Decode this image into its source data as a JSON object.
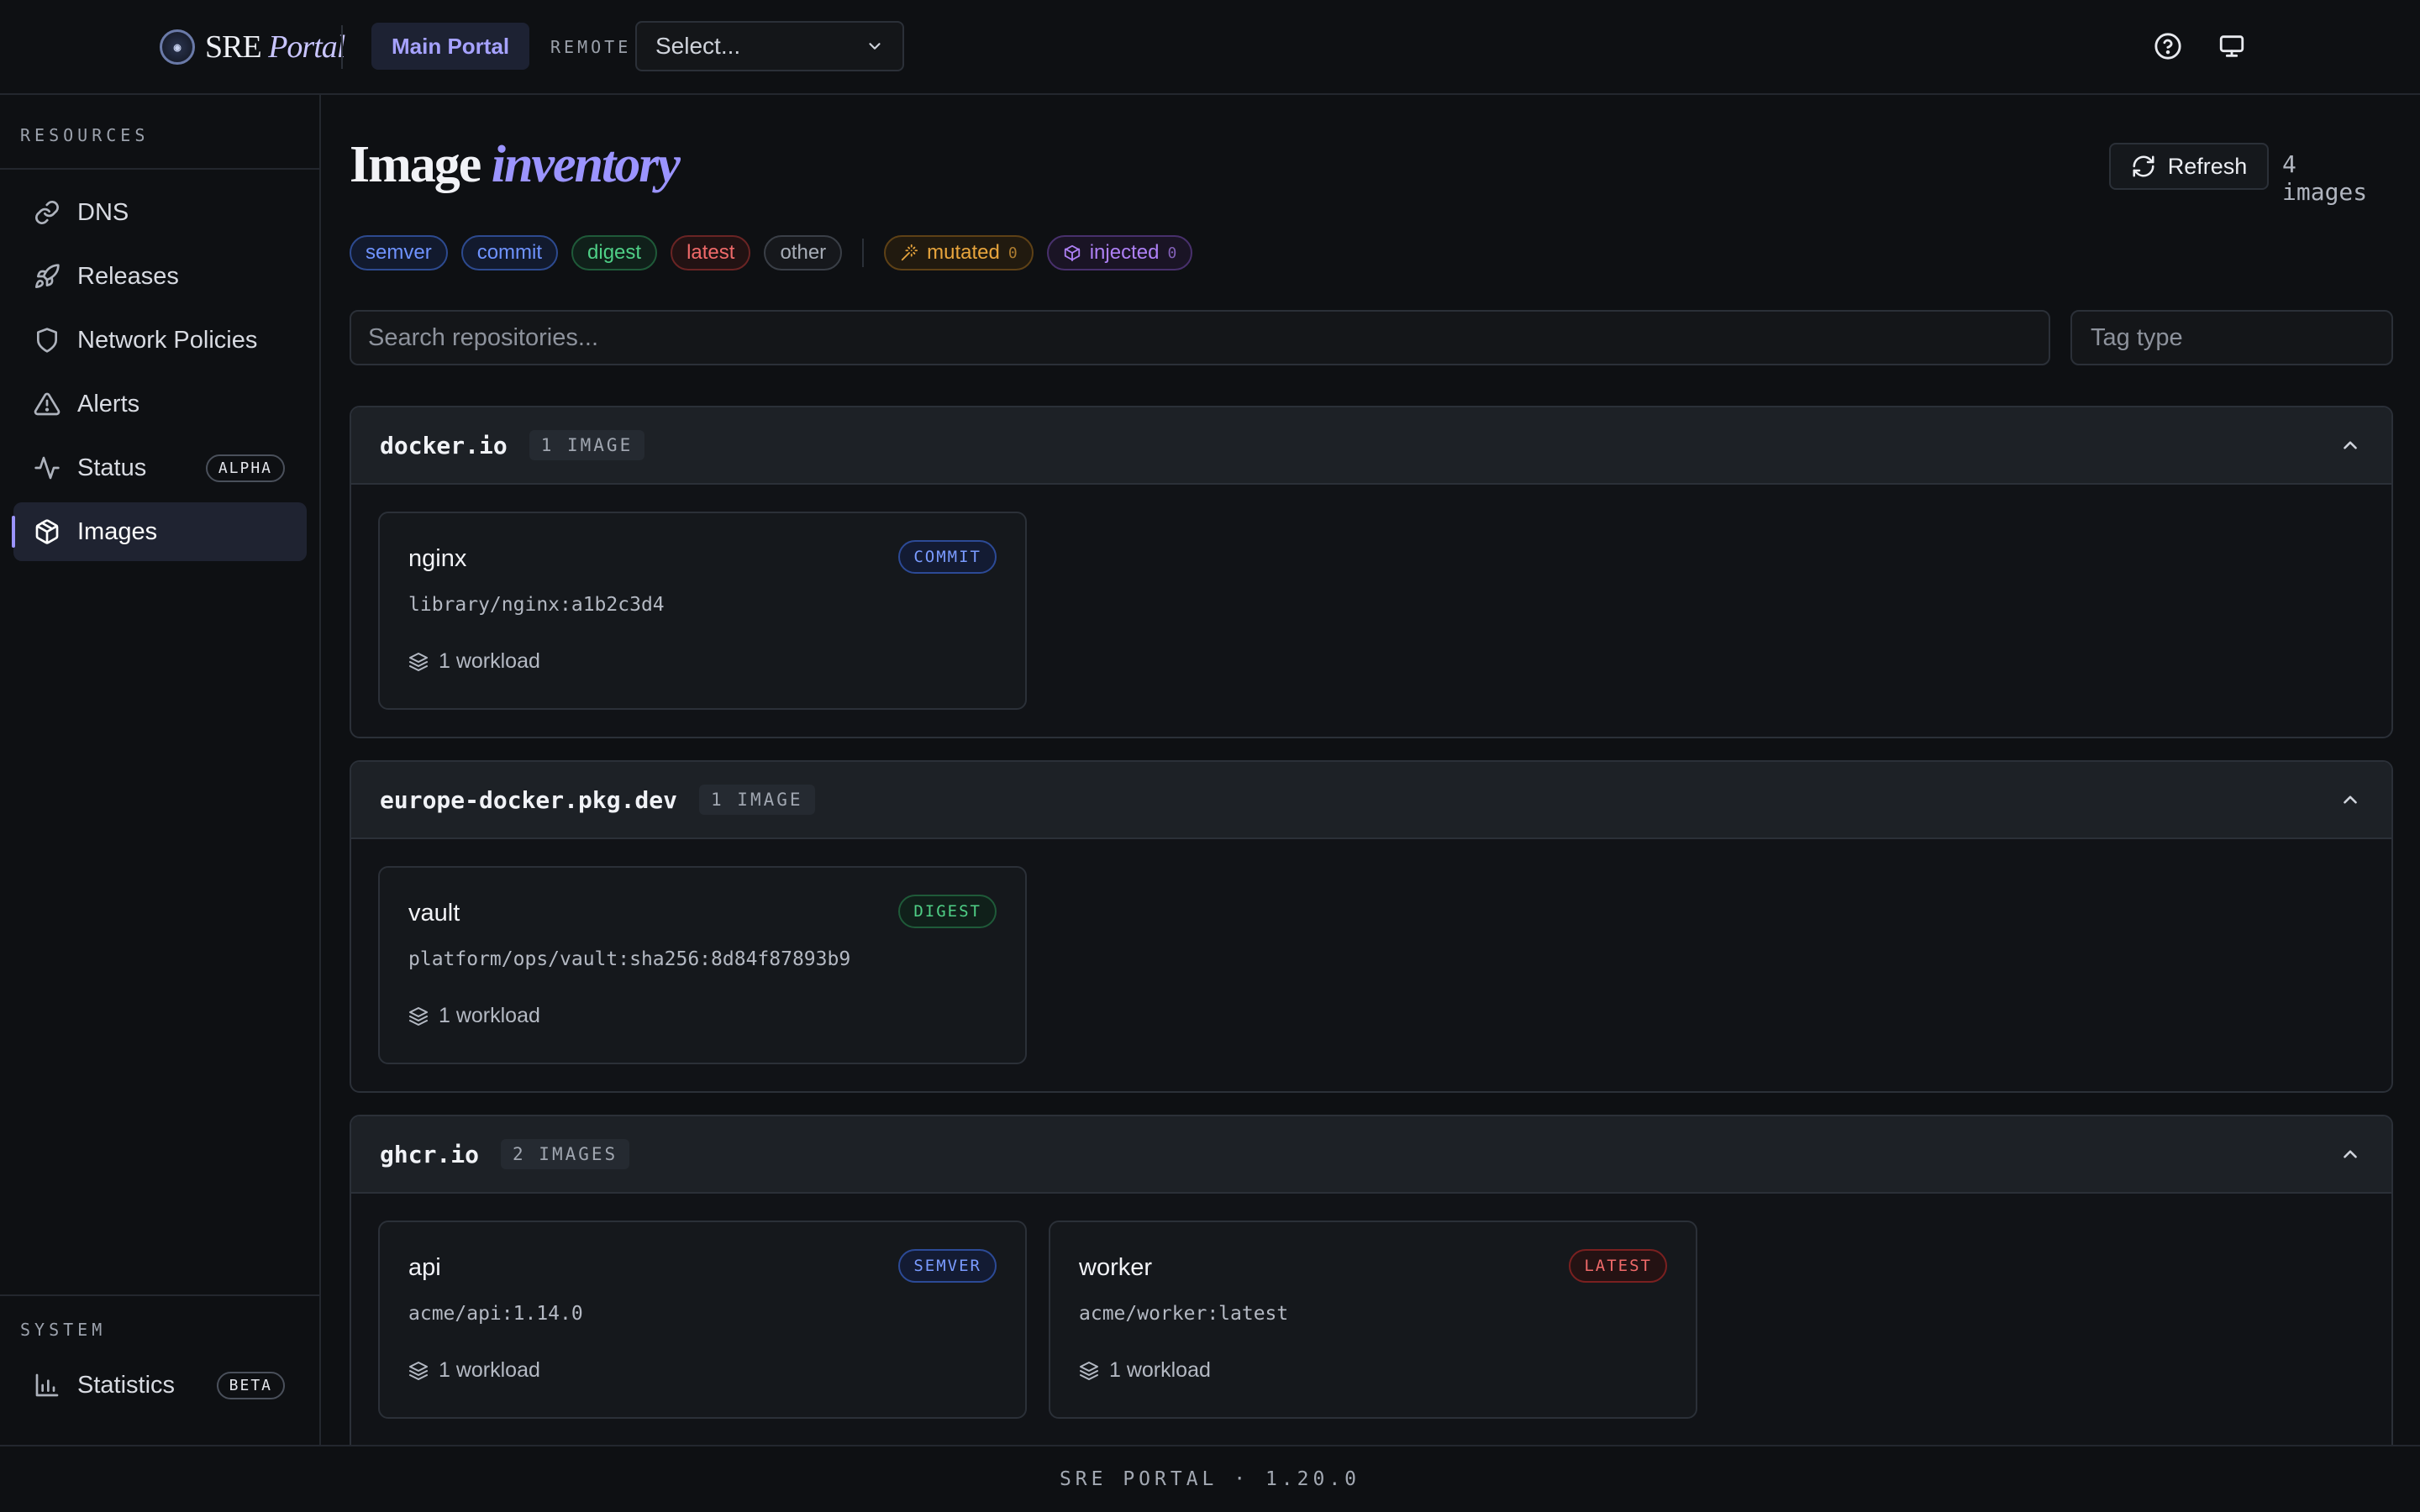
{
  "header": {
    "brand_primary": "SRE",
    "brand_secondary": "Portal",
    "main_portal": "Main Portal",
    "remote_label": "REMOTE",
    "remote_select": "Select...",
    "icons": [
      "help-circle-icon",
      "monitor-icon"
    ]
  },
  "sidebar": {
    "resources_label": "RESOURCES",
    "items": [
      {
        "label": "DNS",
        "icon": "link-icon"
      },
      {
        "label": "Releases",
        "icon": "rocket-icon"
      },
      {
        "label": "Network Policies",
        "icon": "shield-icon"
      },
      {
        "label": "Alerts",
        "icon": "alert-triangle-icon"
      },
      {
        "label": "Status",
        "icon": "activity-icon",
        "badge": "ALPHA"
      },
      {
        "label": "Images",
        "icon": "package-icon",
        "active": true
      }
    ],
    "system_label": "SYSTEM",
    "system_items": [
      {
        "label": "Statistics",
        "icon": "bar-chart-icon",
        "badge": "BETA"
      }
    ]
  },
  "page": {
    "title_plain": "Image",
    "title_italic": "inventory",
    "refresh_label": "Refresh",
    "image_count": "4 images",
    "filters": {
      "chips": [
        {
          "label": "semver",
          "color": "#5b8cff"
        },
        {
          "label": "commit",
          "color": "#5b8cff"
        },
        {
          "label": "digest",
          "color": "#43c07a"
        },
        {
          "label": "latest",
          "color": "#ef5a5a"
        },
        {
          "label": "other",
          "color": "#9aa0aa"
        }
      ],
      "mutated": {
        "label": "mutated",
        "count": "0",
        "color": "#e3a33b"
      },
      "injected": {
        "label": "injected",
        "count": "0",
        "color": "#a779f0"
      }
    },
    "search_placeholder": "Search repositories...",
    "tag_type_placeholder": "Tag type"
  },
  "groups": [
    {
      "registry": "docker.io",
      "count": "1 IMAGE",
      "images": [
        {
          "name": "nginx",
          "badge": "COMMIT",
          "badge_color": "#6a8cff",
          "ref": "library/nginx:a1b2c3d4",
          "workloads": "1 workload"
        }
      ]
    },
    {
      "registry": "europe-docker.pkg.dev",
      "count": "1 IMAGE",
      "images": [
        {
          "name": "vault",
          "badge": "DIGEST",
          "badge_color": "#43c07a",
          "ref": "platform/ops/vault:sha256:8d84f87893b9",
          "workloads": "1 workload"
        }
      ]
    },
    {
      "registry": "ghcr.io",
      "count": "2 IMAGES",
      "images": [
        {
          "name": "api",
          "badge": "SEMVER",
          "badge_color": "#6a8cff",
          "ref": "acme/api:1.14.0",
          "workloads": "1 workload"
        },
        {
          "name": "worker",
          "badge": "LATEST",
          "badge_color": "#ef5a5a",
          "ref": "acme/worker:latest",
          "workloads": "1 workload"
        }
      ]
    }
  ],
  "footer": {
    "text": "SRE PORTAL · 1.20.0"
  }
}
